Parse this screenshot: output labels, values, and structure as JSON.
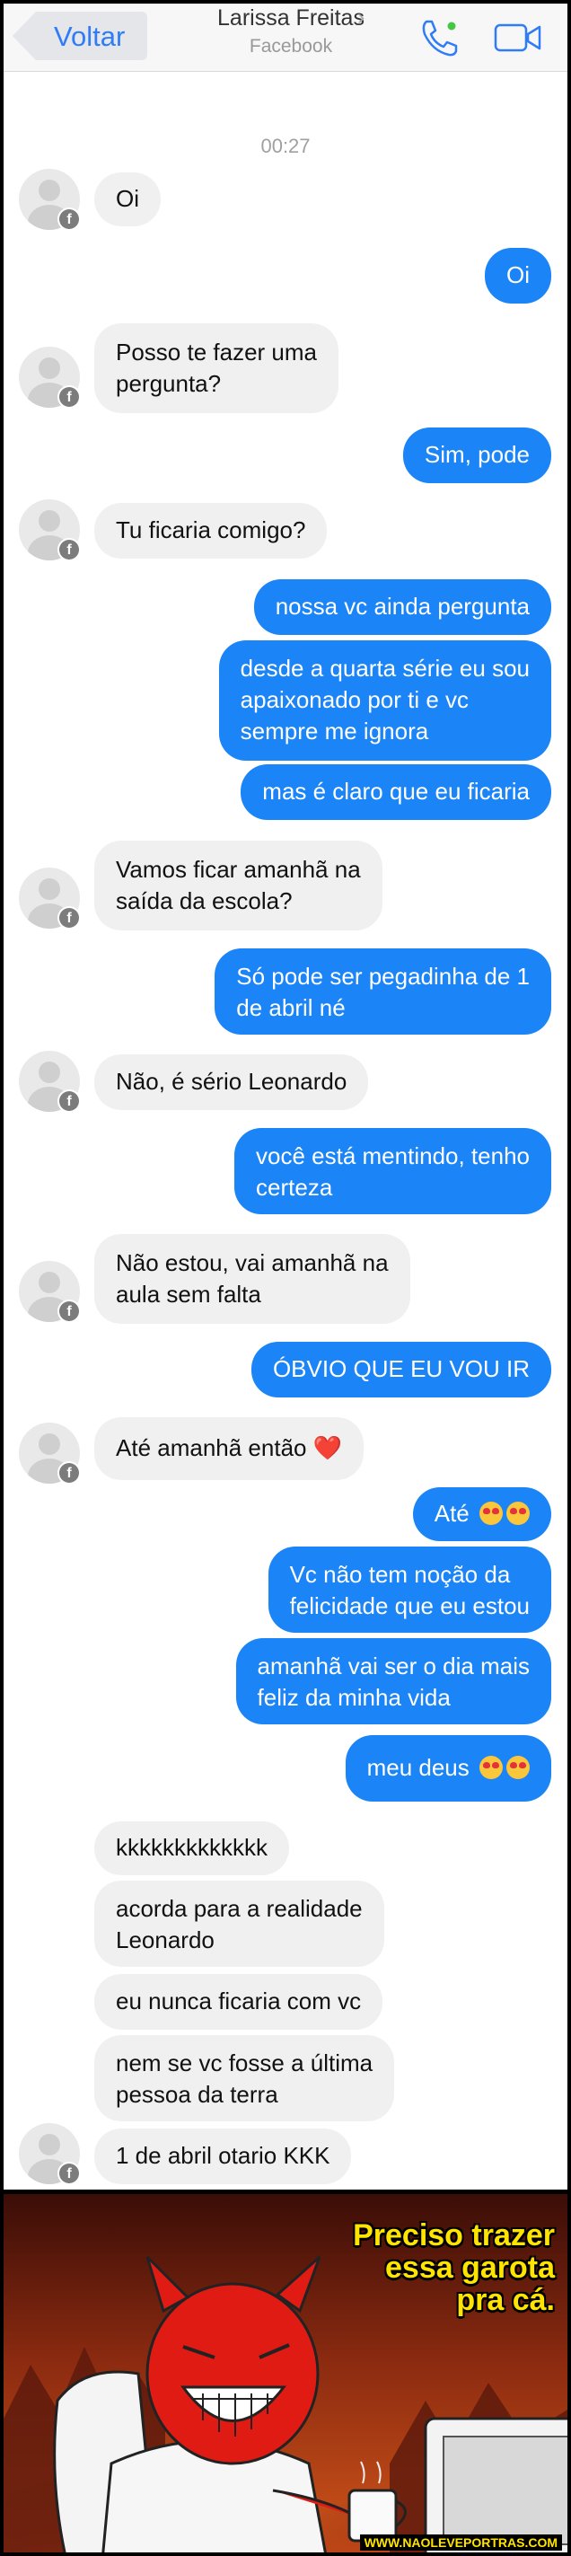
{
  "header": {
    "back_label": "Voltar",
    "contact_name": "Larissa Freitas",
    "contact_source": "Facebook",
    "chevron": "›",
    "call_icon": "phone-icon",
    "video_icon": "video-camera-icon"
  },
  "colors": {
    "accent": "#1b84f6",
    "incoming_bubble": "#f1f0f0",
    "header_bg": "#f7f7f8",
    "comic_caption": "#ffe400"
  },
  "timestamp": "00:27",
  "messages": [
    {
      "from": "them",
      "text": "Oi"
    },
    {
      "from": "me",
      "text": "Oi"
    },
    {
      "from": "them",
      "text": "Posso te fazer uma\npergunta?"
    },
    {
      "from": "me",
      "text": "Sim, pode"
    },
    {
      "from": "them",
      "text": "Tu ficaria comigo?"
    },
    {
      "from": "me",
      "text": "nossa vc ainda pergunta"
    },
    {
      "from": "me",
      "text": "desde a quarta série eu sou\napaixonado por ti e vc\nsempre me ignora"
    },
    {
      "from": "me",
      "text": "mas é claro que eu ficaria"
    },
    {
      "from": "them",
      "text": "Vamos ficar amanhã na\nsaída da escola?"
    },
    {
      "from": "me",
      "text": "Só pode ser pegadinha de 1\nde abril né"
    },
    {
      "from": "them",
      "text": "Não, é sério Leonardo"
    },
    {
      "from": "me",
      "text": "você está mentindo, tenho\ncerteza"
    },
    {
      "from": "them",
      "text": "Não estou, vai amanhã na\naula sem falta"
    },
    {
      "from": "me",
      "text": "ÓBVIO QUE EU VOU IR"
    },
    {
      "from": "them",
      "text": "Até amanhã então",
      "emoji": "❤️"
    },
    {
      "from": "me",
      "text": "Até",
      "emoji": "😍😍"
    },
    {
      "from": "me",
      "text": "Vc não tem noção da\nfelicidade que eu estou"
    },
    {
      "from": "me",
      "text": "amanhã vai ser o dia mais\nfeliz da minha vida"
    },
    {
      "from": "me",
      "text": "meu deus",
      "emoji": "😍😍"
    },
    {
      "from": "them",
      "text": "kkkkkkkkkkkkk"
    },
    {
      "from": "them",
      "text": "acorda para a realidade\nLeonardo"
    },
    {
      "from": "them",
      "text": "eu nunca ficaria com vc"
    },
    {
      "from": "them",
      "text": "nem se vc fosse a última\npessoa da terra"
    },
    {
      "from": "them",
      "text": "1 de abril otario KKK"
    }
  ],
  "comic": {
    "caption": "Preciso trazer\nessa garota\npra cá.",
    "watermark": "WWW.NAOLEVEPORTRAS.COM"
  }
}
